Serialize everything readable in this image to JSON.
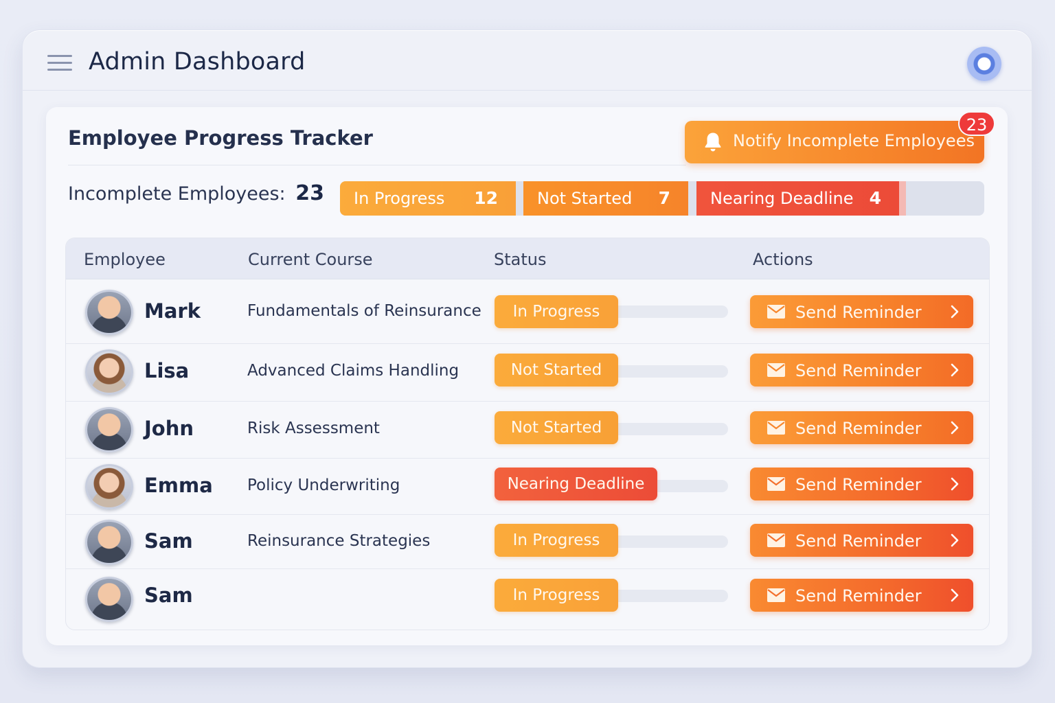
{
  "app": {
    "title": "Admin Dashboard"
  },
  "card": {
    "title": "Employee Progress Tracker",
    "notify_button": {
      "label": "Notify Incomplete Employees",
      "badge": "23"
    },
    "incomplete": {
      "label": "Incomplete Employees:",
      "count": "23"
    },
    "summary": [
      {
        "label": "In Progress",
        "count": "12",
        "color": "#fba73a"
      },
      {
        "label": "Not Started",
        "count": "7",
        "color": "#f78a2a"
      },
      {
        "label": "Nearing Deadline",
        "count": "4",
        "color": "#ee503a"
      }
    ]
  },
  "table": {
    "headers": [
      "Employee",
      "Current Course",
      "Status",
      "Actions"
    ],
    "action_label": "Send Reminder",
    "rows": [
      {
        "name": "Mark",
        "course": "Fundamentals of Reinsurance",
        "status": "In Progress"
      },
      {
        "name": "Lisa",
        "course": "Advanced Claims Handling",
        "status": "Not Started"
      },
      {
        "name": "John",
        "course": "Risk Assessment",
        "status": "Not Started"
      },
      {
        "name": "Emma",
        "course": "Policy Underwriting",
        "status": "Nearing Deadline"
      },
      {
        "name": "Sam",
        "course": "Reinsurance Strategies",
        "status": "In Progress"
      },
      {
        "name": "Sam",
        "course": "",
        "status": "In Progress"
      }
    ]
  },
  "icons": {
    "menu": "hamburger-menu-icon",
    "profile": "profile-icon",
    "notify": "bell-icon",
    "reminder": "mail-icon",
    "reminder_arrow": "chevron-right-icon"
  }
}
